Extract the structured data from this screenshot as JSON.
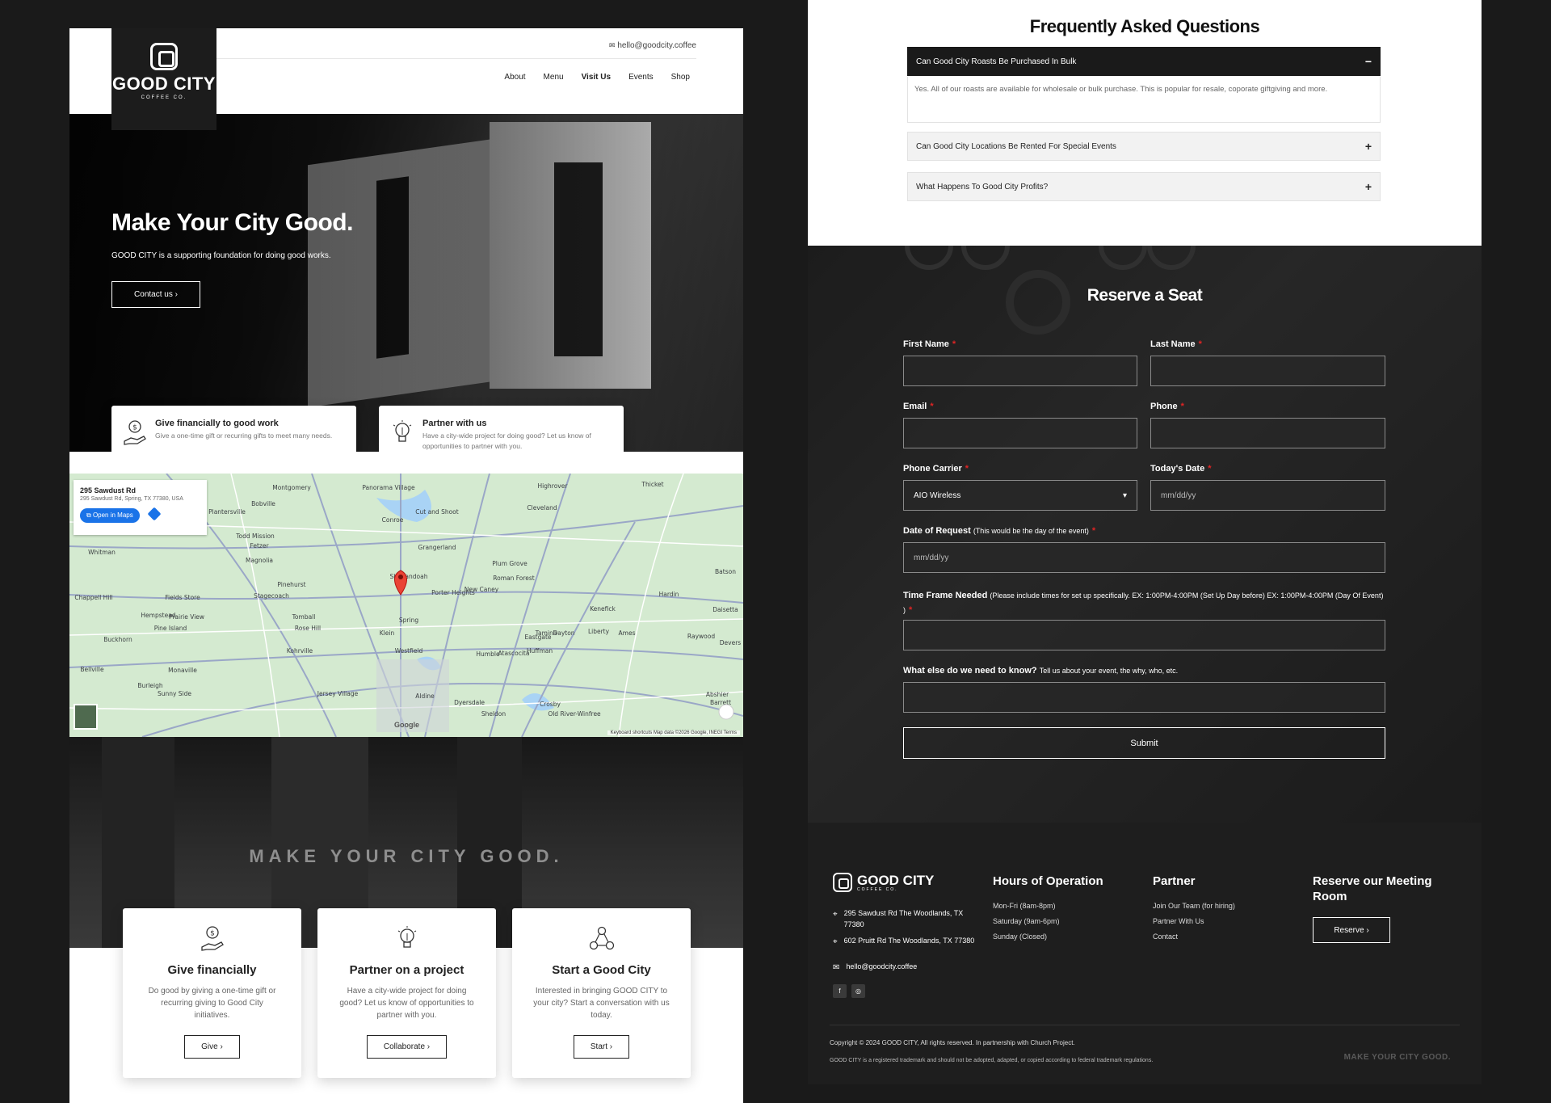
{
  "left": {
    "header": {
      "logo_text": "GOOD CITY",
      "logo_sub": "COFFEE CO.",
      "email": "hello@goodcity.coffee",
      "nav": [
        "About",
        "Menu",
        "Visit Us",
        "Events",
        "Shop"
      ]
    },
    "hero": {
      "title": "Make Your City Good.",
      "subtitle": "GOOD CITY is a supporting foundation for doing good works.",
      "button": "Contact us ›"
    },
    "cards": [
      {
        "title": "Give financially to good work",
        "desc": "Give a one-time gift or recurring gifts to meet many needs.",
        "icon": "hand-dollar-icon"
      },
      {
        "title": "Partner with us",
        "desc": "Have a city-wide project for doing good? Let us know of opportunities to partner with you.",
        "icon": "lightbulb-icon"
      }
    ],
    "map": {
      "address": "295 Sawdust Rd",
      "address_full": "295 Sawdust Rd, Spring, TX 77380, USA",
      "open_button": "Open in Maps",
      "attribution": "Keyboard shortcuts   Map data ©2026 Google, INEGI   Terms",
      "google": "Google",
      "places": [
        "Montgomery",
        "Panorama Village",
        "Highrover",
        "Thicket",
        "Plantersville",
        "Bobville",
        "Conroe",
        "Cut and Shoot",
        "Cleveland",
        "Todd Mission",
        "Grangerland",
        "Magnolia",
        "Whitman",
        "Pinehurst",
        "Shenandoah",
        "Plum Grove",
        "Chappell Hill",
        "Fields Store",
        "Stagecoach",
        "Porter Heights",
        "New Caney",
        "Roman Forest",
        "Hardin",
        "Hempstead",
        "Prairie View",
        "Tomball",
        "Kenefick",
        "Pine Island",
        "Rose Hill",
        "Klein",
        "Spring",
        "Dayton",
        "Liberty",
        "Ames",
        "Bellville",
        "Kohrville",
        "Westfield",
        "Humble",
        "Atascocita",
        "Huffman",
        "Monaville",
        "Burleigh",
        "Sunny Side",
        "Jersey Village",
        "Aldine",
        "Dyersdale",
        "Sheldon",
        "Crosby",
        "Old River-Winfree",
        "Batson",
        "Daisetta",
        "Raywood",
        "Devers",
        "Eastgate",
        "Buckhorn",
        "Fetzer",
        "Tamina",
        "Abshier",
        "Barrett"
      ]
    },
    "bottom": {
      "motto": "MAKE YOUR CITY GOOD.",
      "cards": [
        {
          "title": "Give financially",
          "desc": "Do good by giving a one-time gift or recurring giving to Good City initiatives.",
          "button": "Give ›",
          "icon": "hand-dollar-icon"
        },
        {
          "title": "Partner on a project",
          "desc": "Have a city-wide project for doing good? Let us know of opportunities to partner with you.",
          "button": "Collaborate ›",
          "icon": "lightbulb-icon"
        },
        {
          "title": "Start a Good City",
          "desc": "Interested in bringing GOOD CITY to your city? Start a conversation with us today.",
          "button": "Start ›",
          "icon": "people-network-icon"
        }
      ]
    }
  },
  "right": {
    "faq": {
      "title": "Frequently Asked Questions",
      "items": [
        {
          "q": "Can Good City Roasts Be Purchased In Bulk",
          "a": "Yes. All of our roasts are available for wholesale or bulk purchase. This is popular for resale, coporate giftgiving and more.",
          "toggle": "−"
        },
        {
          "q": "Can Good City Locations Be Rented For Special Events",
          "toggle": "+"
        },
        {
          "q": "What Happens To Good City Profits?",
          "toggle": "+"
        }
      ]
    },
    "form": {
      "title": "Reserve a Seat",
      "first_name": "First Name",
      "last_name": "Last Name",
      "email": "Email",
      "phone": "Phone",
      "carrier": "Phone Carrier",
      "carrier_value": "AIO Wireless",
      "today": "Today's Date",
      "date_placeholder": "mm/dd/yy",
      "date_request": "Date of Request",
      "date_request_note": "(This would be the day of the event)",
      "timeframe": "Time Frame Needed",
      "timeframe_note": "(Please include times for set up specifically. EX: 1:00PM-4:00PM (Set Up Day before) EX: 1:00PM-4:00PM (Day Of Event) )",
      "else": "What else do we need to know?",
      "else_note": "Tell us about your event, the why, who, etc.",
      "submit": "Submit",
      "required": "*"
    },
    "footer": {
      "logo_text": "GOOD CITY",
      "logo_sub": "COFFEE CO.",
      "address1": "295 Sawdust Rd The Woodlands, TX 77380",
      "address2": "602 Pruitt Rd The Woodlands, TX 77380",
      "email": "hello@goodcity.coffee",
      "hours_title": "Hours of Operation",
      "hours": [
        "Mon-Fri (8am-8pm)",
        "Saturday (9am-6pm)",
        "Sunday (Closed)"
      ],
      "partner_title": "Partner",
      "partner_links": [
        "Join Our Team (for hiring)",
        "Partner With Us",
        "Contact"
      ],
      "reserve_title": "Reserve our Meeting Room",
      "reserve_button": "Reserve ›",
      "copyright": "Copyright © 2024 GOOD CITY, All rights reserved. In partnership with Church Project.",
      "trademark": "GOOD CITY is a registered trademark and should not be adopted, adapted, or copied according to federal trademark regulations.",
      "motto": "MAKE YOUR CITY GOOD."
    }
  }
}
